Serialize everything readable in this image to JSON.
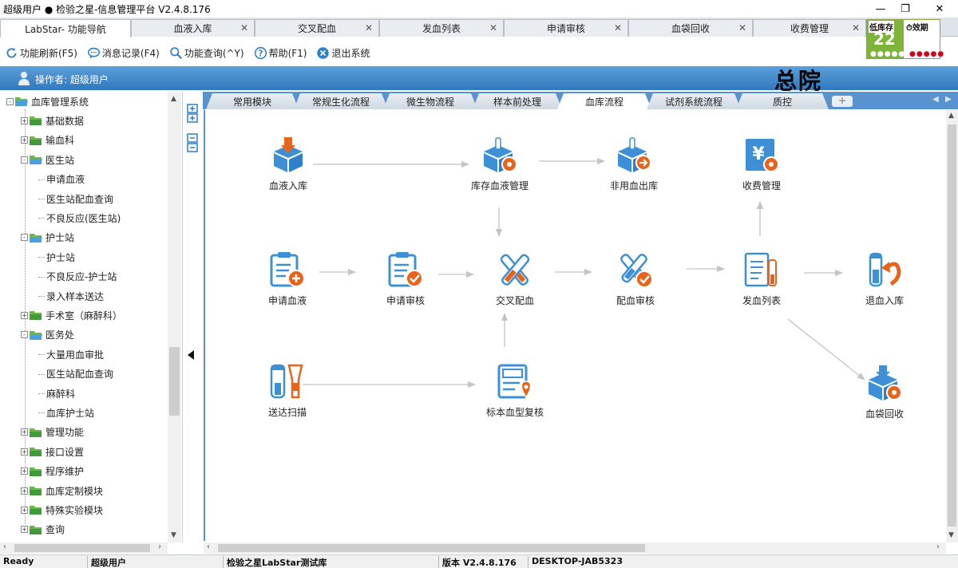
{
  "window": {
    "title": "超级用户  ●  检验之星-信息管理平台  V2.4.8.176",
    "controls": {
      "minimize": "—",
      "restore": "❐",
      "close": "✕"
    }
  },
  "doc_tabs": [
    {
      "label": "LabStar- 功能导航",
      "active": true,
      "closable": false
    },
    {
      "label": "血液入库",
      "active": false,
      "closable": true
    },
    {
      "label": "交叉配血",
      "active": false,
      "closable": true
    },
    {
      "label": "发血列表",
      "active": false,
      "closable": true
    },
    {
      "label": "申请审核",
      "active": false,
      "closable": true
    },
    {
      "label": "血袋回收",
      "active": false,
      "closable": true
    },
    {
      "label": "收费管理",
      "active": false,
      "closable": true
    }
  ],
  "alert": {
    "low_stock_label": "低库存",
    "low_stock_count": "22",
    "low_stock_dots": "●●●●●",
    "expiry_label": "效期",
    "expiry_dots": "●●●●●"
  },
  "toolbar": [
    {
      "label": "功能刷新(F5)",
      "icon": "refresh-icon"
    },
    {
      "label": "消息记录(F4)",
      "icon": "message-icon"
    },
    {
      "label": "功能查询(^Y)",
      "icon": "search-icon"
    },
    {
      "label": "帮助(F1)",
      "icon": "help-icon"
    },
    {
      "label": "退出系统",
      "icon": "exit-icon"
    }
  ],
  "operator": {
    "label": "操作者: 超级用户",
    "hospital": "总院"
  },
  "tree": [
    {
      "label": "血库管理系统",
      "level": 0,
      "type": "folder-open",
      "toggle": "-"
    },
    {
      "label": "基础数据",
      "level": 1,
      "type": "folder",
      "toggle": "+"
    },
    {
      "label": "输血科",
      "level": 1,
      "type": "folder",
      "toggle": "+"
    },
    {
      "label": "医生站",
      "level": 1,
      "type": "folder-open",
      "toggle": "-"
    },
    {
      "label": "申请血液",
      "level": 2,
      "type": "leaf"
    },
    {
      "label": "医生站配血查询",
      "level": 2,
      "type": "leaf"
    },
    {
      "label": "不良反应(医生站)",
      "level": 2,
      "type": "leaf"
    },
    {
      "label": "护士站",
      "level": 1,
      "type": "folder-open",
      "toggle": "-"
    },
    {
      "label": "护士站",
      "level": 2,
      "type": "leaf"
    },
    {
      "label": "不良反应-护士站",
      "level": 2,
      "type": "leaf"
    },
    {
      "label": "录入样本送达",
      "level": 2,
      "type": "leaf"
    },
    {
      "label": "手术室（麻醉科）",
      "level": 1,
      "type": "folder",
      "toggle": "+"
    },
    {
      "label": "医务处",
      "level": 1,
      "type": "folder-open",
      "toggle": "-"
    },
    {
      "label": "大量用血审批",
      "level": 2,
      "type": "leaf"
    },
    {
      "label": "医生站配血查询",
      "level": 2,
      "type": "leaf"
    },
    {
      "label": "麻醉科",
      "level": 2,
      "type": "leaf"
    },
    {
      "label": "血库护士站",
      "level": 2,
      "type": "leaf"
    },
    {
      "label": "管理功能",
      "level": 1,
      "type": "folder",
      "toggle": "+"
    },
    {
      "label": "接口设置",
      "level": 1,
      "type": "folder",
      "toggle": "+"
    },
    {
      "label": "程序维护",
      "level": 1,
      "type": "folder",
      "toggle": "+"
    },
    {
      "label": "血库定制模块",
      "level": 1,
      "type": "folder",
      "toggle": "+"
    },
    {
      "label": "特殊实验模块",
      "level": 1,
      "type": "folder",
      "toggle": "+"
    },
    {
      "label": "查询",
      "level": 1,
      "type": "folder",
      "toggle": "+"
    }
  ],
  "inner_tabs": [
    {
      "label": "常用模块",
      "active": false
    },
    {
      "label": "常规生化流程",
      "active": false
    },
    {
      "label": "微生物流程",
      "active": false
    },
    {
      "label": "样本前处理",
      "active": false
    },
    {
      "label": "血库流程",
      "active": true
    },
    {
      "label": "试剂系统流程",
      "active": false
    },
    {
      "label": "质控",
      "active": false
    }
  ],
  "flow_nodes": {
    "blood_in": {
      "label": "血液入库",
      "icon": "box-download-icon"
    },
    "inventory": {
      "label": "库存血液管理",
      "icon": "box-gear-icon"
    },
    "nonuse_out": {
      "label": "非用血出库",
      "icon": "box-export-icon"
    },
    "fee": {
      "label": "收费管理",
      "icon": "yen-gear-icon"
    },
    "apply": {
      "label": "申请血液",
      "icon": "clipboard-add-icon"
    },
    "apply_review": {
      "label": "申请审核",
      "icon": "clipboard-check-icon"
    },
    "crossmatch": {
      "label": "交叉配血",
      "icon": "tubes-cross-icon"
    },
    "match_review": {
      "label": "配血审核",
      "icon": "tubes-check-icon"
    },
    "issue_list": {
      "label": "发血列表",
      "icon": "document-tube-icon"
    },
    "return_in": {
      "label": "退血入库",
      "icon": "tube-return-icon"
    },
    "deliver_scan": {
      "label": "送达扫描",
      "icon": "tube-scanner-icon"
    },
    "specimen_recheck": {
      "label": "标本血型复核",
      "icon": "tube-rack-pin-icon"
    },
    "bag_recycle": {
      "label": "血袋回收",
      "icon": "box-recycle-icon"
    }
  },
  "status": {
    "state": "Ready",
    "user": "超级用户",
    "database": "检验之星LabStar测试库",
    "version": "版本 V2.4.8.176",
    "machine": "DESKTOP-JAB5323"
  },
  "colors": {
    "blue": "#3d8fd6",
    "orange": "#e8641b",
    "header_blue": "#3a84c8",
    "tab_blue": "#5893cf"
  }
}
